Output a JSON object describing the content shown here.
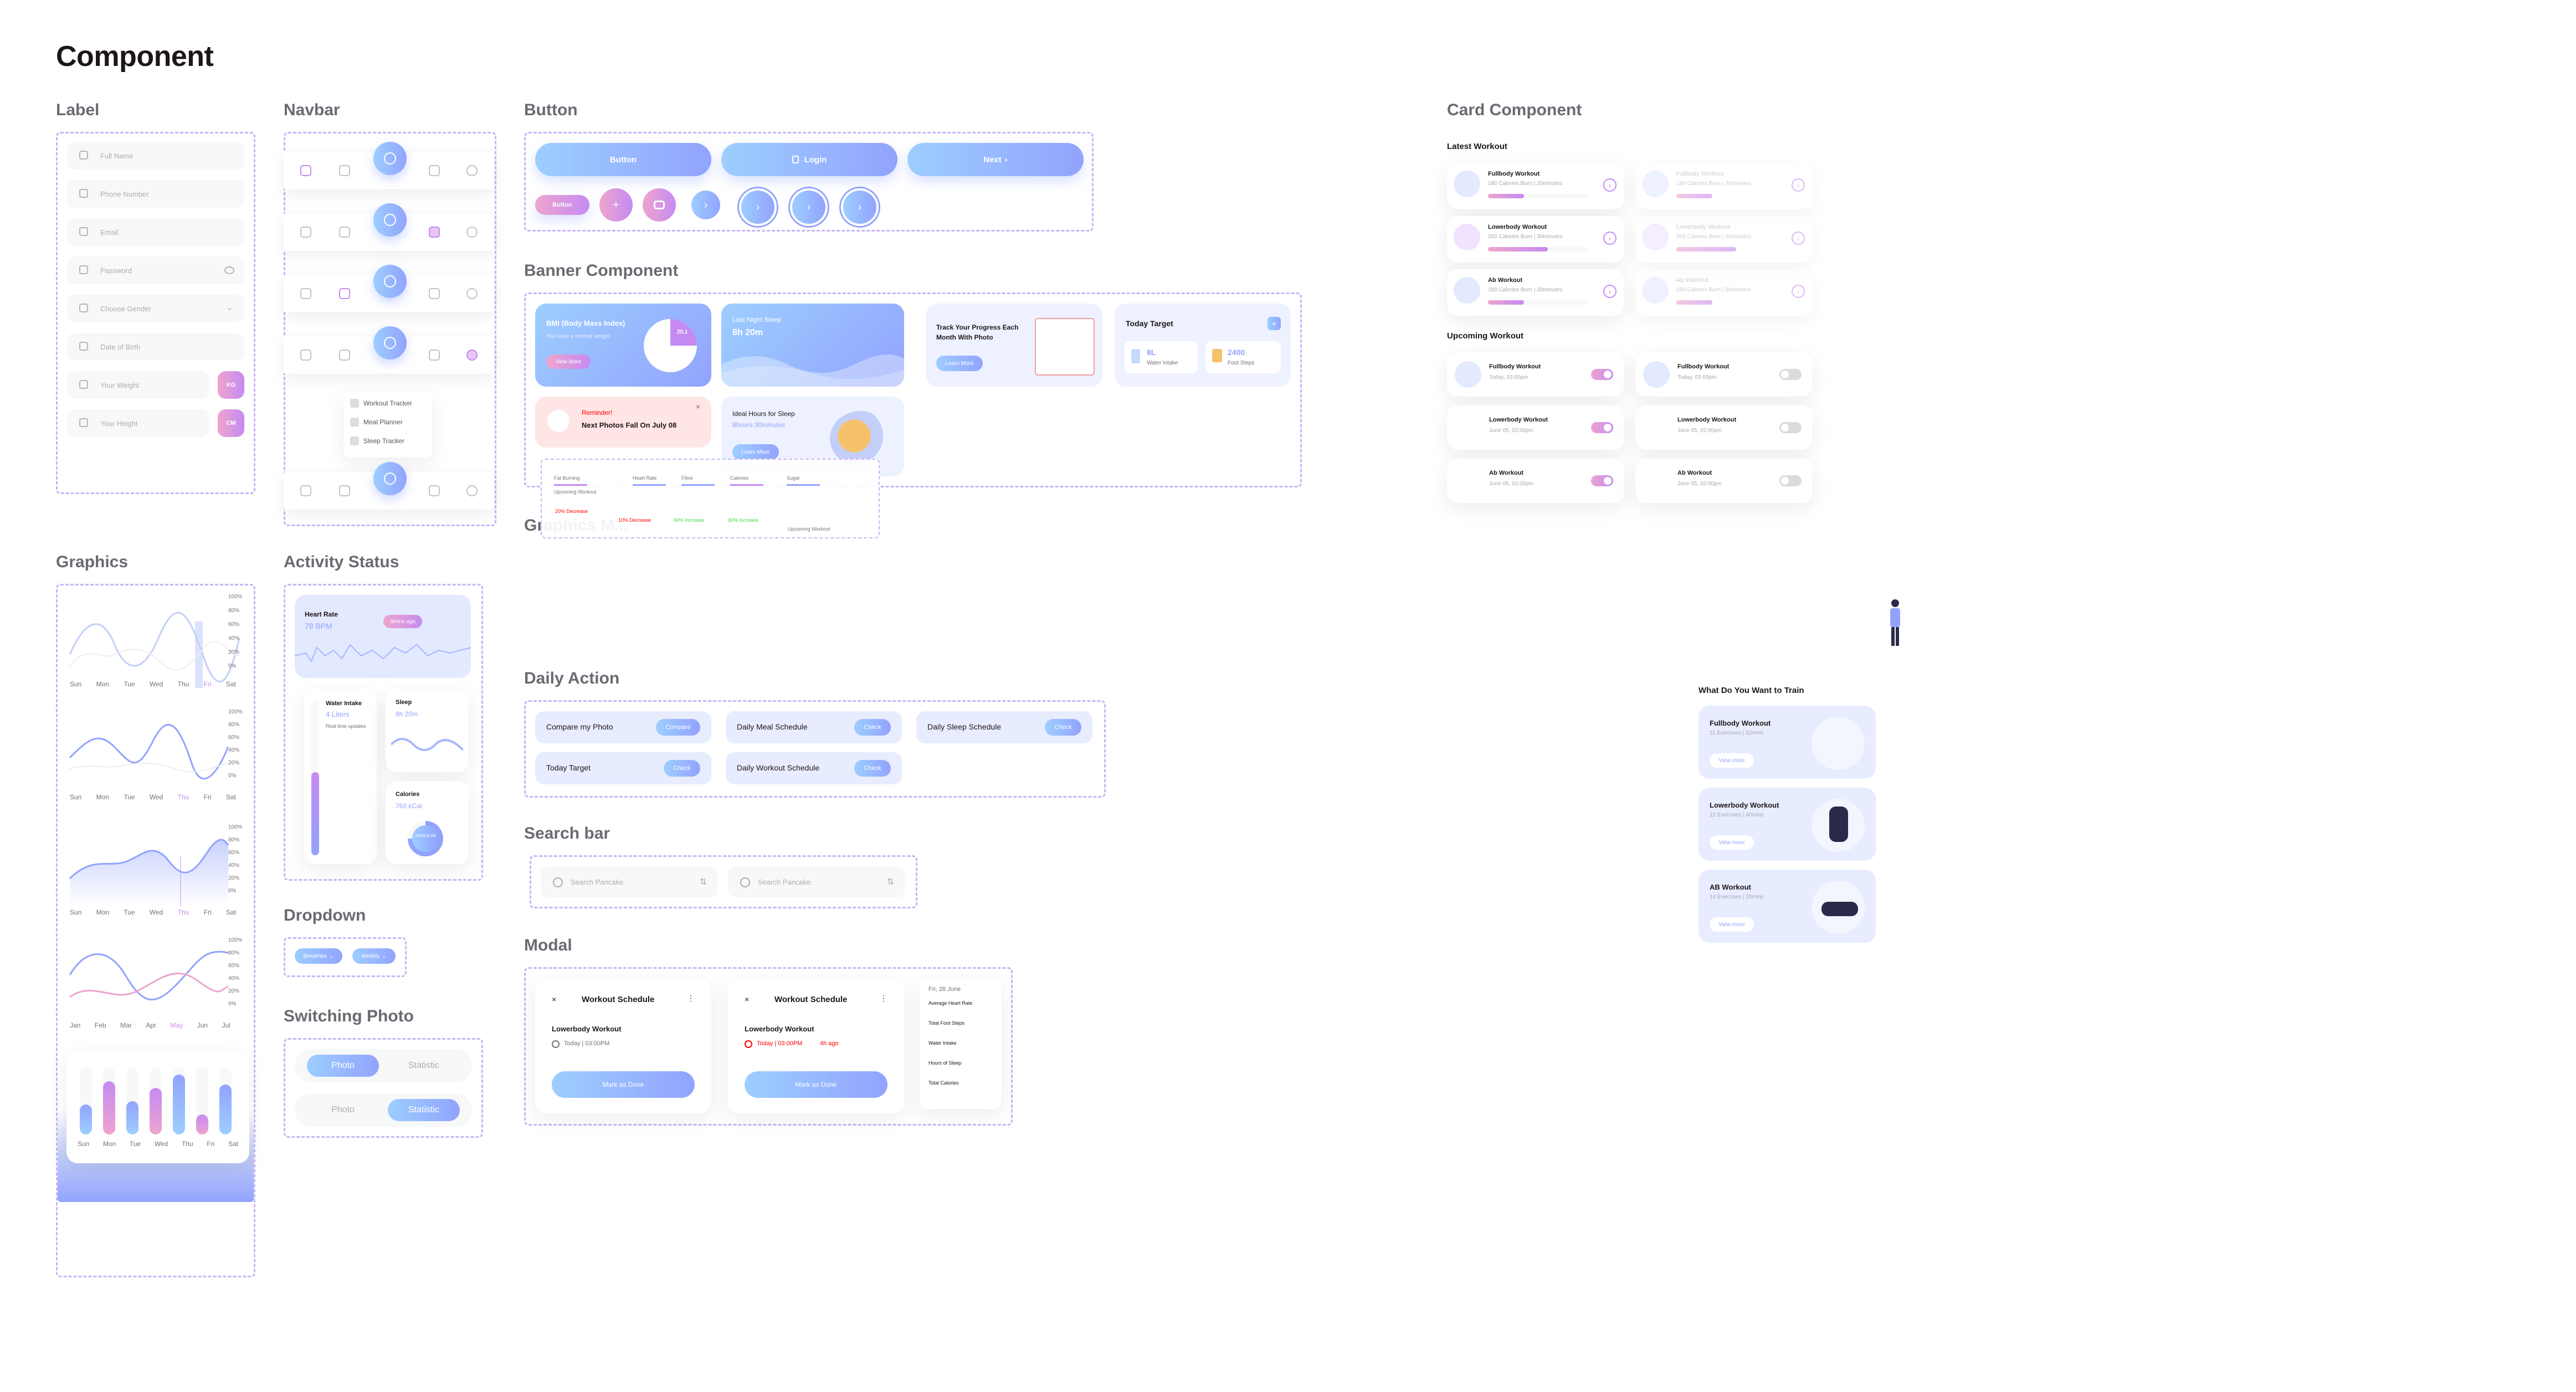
{
  "page_title": "Component",
  "sections": {
    "label": "Label",
    "navbar": "Navbar",
    "button": "Button",
    "banner": "Banner Component",
    "card": "Card Component",
    "graphics": "Graphics",
    "activity": "Activity Status",
    "graphics_more": "Graphics M...",
    "daily_action": "Daily Action",
    "search_bar": "Search bar",
    "dropdown": "Dropdown",
    "switching_photo": "Switching Photo",
    "modal": "Modal"
  },
  "label_fields": [
    {
      "placeholder": "Full Name",
      "icon": "user-icon"
    },
    {
      "placeholder": "Phone Number",
      "icon": "phone-icon"
    },
    {
      "placeholder": "Email",
      "icon": "mail-icon"
    },
    {
      "placeholder": "Password",
      "icon": "lock-icon"
    },
    {
      "placeholder": "Choose Gender",
      "icon": "gender-icon"
    },
    {
      "placeholder": "Date of Birth",
      "icon": "calendar-icon"
    },
    {
      "placeholder": "Your Weight",
      "icon": "scale-icon",
      "unit": "KG"
    },
    {
      "placeholder": "Your Height",
      "icon": "height-icon",
      "unit": "CM"
    }
  ],
  "navbar_menu": [
    "Workout Tracker",
    "Meal Planner",
    "Sleep Tracker"
  ],
  "buttons": {
    "button": "Button",
    "login": "Login",
    "next": "Next",
    "small": "Button"
  },
  "banner": {
    "bmi_title": "BMI (Body Mass Index)",
    "bmi_sub": "You have a normal weight",
    "bmi_button": "View More",
    "bmi_value": "20,1",
    "sleep_title": "Last Night Sleep",
    "sleep_value": "8h 20m",
    "progress_title": "Track Your Progress Each Month With Photo",
    "progress_button": "Learn More",
    "target_title": "Today Target",
    "target_water_value": "8L",
    "target_water_label": "Water Intake",
    "target_steps_value": "2400",
    "target_steps_label": "Foot Steps",
    "reminder_title": "Reminder!",
    "reminder_text": "Next Photos Fall On July 08",
    "ideal_title": "Ideal Hours for Sleep",
    "ideal_value": "8hours 30minutes",
    "ideal_button": "Learn More"
  },
  "card": {
    "latest_title": "Latest Workout",
    "latest": [
      {
        "name": "Fullbody Workout",
        "sub": "180 Calories Burn | 20minutes",
        "progress": 0.45
      },
      {
        "name": "Lowerbody Workout",
        "sub": "200 Calories Burn | 30minutes",
        "progress": 0.7
      },
      {
        "name": "Ab Workout",
        "sub": "180 Calories Burn | 20minutes",
        "progress": 0.4
      }
    ],
    "upcoming_title": "Upcoming Workout",
    "upcoming": [
      {
        "name": "Fullbody Workout",
        "sub": "Today, 03:00pm"
      },
      {
        "name": "Lowerbody Workout",
        "sub": "June 05, 02:00pm"
      },
      {
        "name": "Ab Workout",
        "sub": "June 05, 02:00pm"
      }
    ],
    "train_title": "What Do You Want to Train",
    "train": [
      {
        "name": "Fullbody Workout",
        "sub": "11 Exercises | 32mins",
        "button": "View more"
      },
      {
        "name": "Lowerbody Workout",
        "sub": "12 Exercises | 40mins",
        "button": "View more"
      },
      {
        "name": "AB Workout",
        "sub": "14 Exercises | 20mins",
        "button": "View more"
      }
    ]
  },
  "graphics": {
    "days": [
      "Sun",
      "Mon",
      "Tue",
      "Wed",
      "Thu",
      "Fri",
      "Sat"
    ],
    "months": [
      "Jan",
      "Feb",
      "Mar",
      "Apr",
      "May",
      "Jun",
      "Jul"
    ],
    "percent_ticks": [
      "100%",
      "80%",
      "60%",
      "40%",
      "20%",
      "0%"
    ],
    "bar_values": [
      0.45,
      0.8,
      0.5,
      0.7,
      0.9,
      0.3,
      0.75
    ]
  },
  "activity": {
    "heart_title": "Heart Rate",
    "heart_value": "78 BPM",
    "heart_badge": "3mins ago",
    "water_title": "Water Intake",
    "water_value": "4 Liters",
    "water_updates": "Real time updates",
    "sleep_title": "Sleep",
    "sleep_value": "8h 20m",
    "calories_title": "Calories",
    "calories_value": "760 kCal",
    "calories_left": "230kCal left"
  },
  "daily_action": [
    {
      "label": "Compare my Photo",
      "button": "Compare"
    },
    {
      "label": "Daily Meal Schedule",
      "button": "Check"
    },
    {
      "label": "Daily Sleep Schedule",
      "button": "Check"
    },
    {
      "label": "Today Target",
      "button": "Check"
    },
    {
      "label": "Daily Workout Schedule",
      "button": "Check"
    }
  ],
  "search": {
    "placeholder": "Search Pancake"
  },
  "dropdown": [
    "Breakfast",
    "Weekly"
  ],
  "switch": {
    "photo": "Photo",
    "statistic": "Statistic"
  },
  "modal": {
    "title": "Workout Schedule",
    "workout": "Lowerbody Workout",
    "time": "Today | 03:00PM",
    "time_late": "Today | 03:00PM",
    "late_note": "4h ago",
    "button": "Mark as Done",
    "date": "Fri, 28 June",
    "stats": [
      "Average Heart Rate",
      "Total Foot Steps",
      "Water Intake",
      "Hours of Sleep",
      "Total Calories"
    ]
  },
  "overlay": {
    "fat_burning": "Fat Burning",
    "heart_rate": "Heart Rate",
    "fibre": "Fibre",
    "calories": "Calories",
    "sugar": "Sugar",
    "upcoming": "Upcoming Workout",
    "decrease": "20% Decrease",
    "decrease2": "10% Decrease",
    "increase": "40% Increase",
    "increase2": "30% Increase"
  }
}
